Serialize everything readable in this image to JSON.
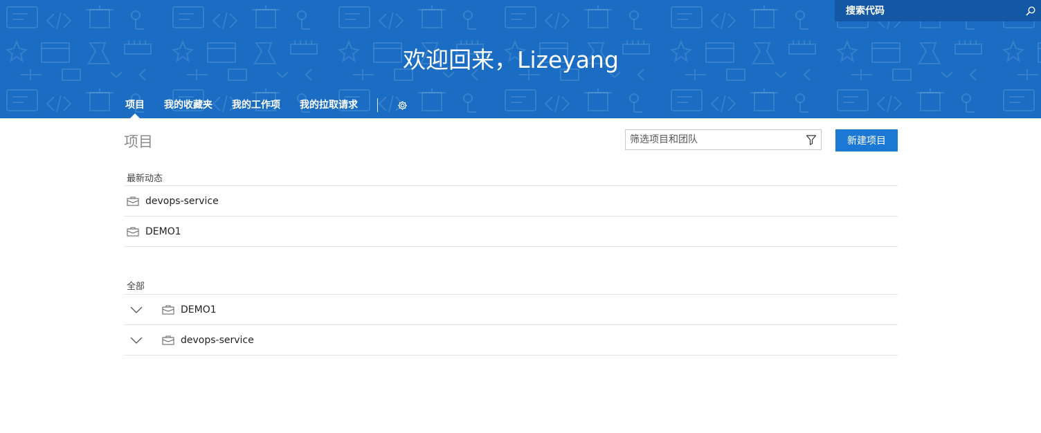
{
  "header": {
    "search_placeholder": "搜索代码",
    "welcome": "欢迎回来，Lizeyang",
    "tabs": [
      {
        "label": "项目",
        "active": true
      },
      {
        "label": "我的收藏夹",
        "active": false
      },
      {
        "label": "我的工作项",
        "active": false
      },
      {
        "label": "我的拉取请求",
        "active": false
      }
    ],
    "settings_icon": "gear-icon"
  },
  "main": {
    "title": "项目",
    "filter_placeholder": "筛选项目和团队",
    "new_button": "新建项目",
    "recent": {
      "title": "最新动态",
      "items": [
        "devops-service",
        "DEMO1"
      ]
    },
    "all": {
      "title": "全部",
      "items": [
        "DEMO1",
        "devops-service"
      ]
    }
  },
  "colors": {
    "banner": "#1a6dc3",
    "search_bg": "#1458a5",
    "primary_button": "#1b78d4"
  }
}
